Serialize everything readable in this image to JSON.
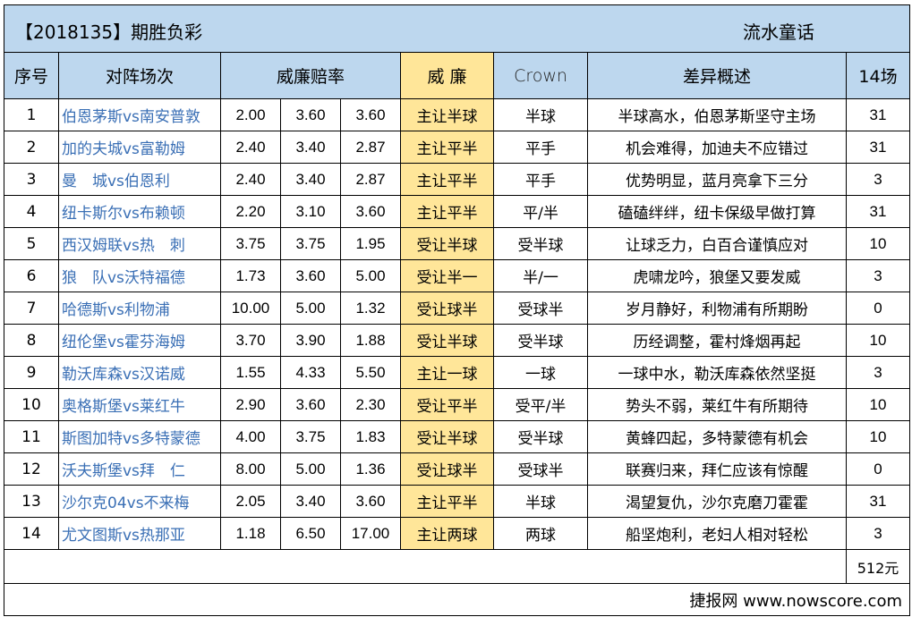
{
  "title": {
    "left": "【2018135】期胜负彩",
    "right": "流水童话"
  },
  "headers": {
    "index": "序号",
    "match": "对阵场次",
    "odds": "威廉赔率",
    "handicap": "威 廉",
    "crown": "Crown",
    "summary": "差异概述",
    "picks": "14场"
  },
  "rows": [
    {
      "index": "1",
      "match": "伯恩茅斯vs南安普敦",
      "odd1": "2.00",
      "odd2": "3.60",
      "odd3": "3.60",
      "handicap": "主让半球",
      "crown": "半球",
      "summary": "半球高水，伯恩茅斯坚守主场",
      "pick": "31"
    },
    {
      "index": "2",
      "match": "加的夫城vs富勒姆",
      "odd1": "2.40",
      "odd2": "3.40",
      "odd3": "2.87",
      "handicap": "主让平半",
      "crown": "平手",
      "summary": "机会难得，加迪夫不应错过",
      "pick": "31"
    },
    {
      "index": "3",
      "match": "曼　城vs伯恩利",
      "odd1": "2.40",
      "odd2": "3.40",
      "odd3": "2.87",
      "handicap": "主让平半",
      "crown": "平手",
      "summary": "优势明显，蓝月亮拿下三分",
      "pick": "3"
    },
    {
      "index": "4",
      "match": "纽卡斯尔vs布赖顿",
      "odd1": "2.20",
      "odd2": "3.10",
      "odd3": "3.60",
      "handicap": "主让平半",
      "crown": "平/半",
      "summary": "磕磕绊绊，纽卡保级早做打算",
      "pick": "31"
    },
    {
      "index": "5",
      "match": "西汉姆联vs热　刺",
      "odd1": "3.75",
      "odd2": "3.75",
      "odd3": "1.95",
      "handicap": "受让半球",
      "crown": "受半球",
      "summary": "让球乏力，白百合谨慎应对",
      "pick": "10"
    },
    {
      "index": "6",
      "match": "狼　队vs沃特福德",
      "odd1": "1.73",
      "odd2": "3.60",
      "odd3": "5.00",
      "handicap": "受让半一",
      "crown": "半/一",
      "summary": "虎啸龙吟，狼堡又要发威",
      "pick": "3"
    },
    {
      "index": "7",
      "match": "哈德斯vs利物浦",
      "odd1": "10.00",
      "odd2": "5.00",
      "odd3": "1.32",
      "handicap": "受让球半",
      "crown": "受球半",
      "summary": "岁月静好，利物浦有所期盼",
      "pick": "0"
    },
    {
      "index": "8",
      "match": "纽伦堡vs霍芬海姆",
      "odd1": "3.70",
      "odd2": "3.90",
      "odd3": "1.88",
      "handicap": "受让半球",
      "crown": "受半球",
      "summary": "历经调整，霍村烽烟再起",
      "pick": "10"
    },
    {
      "index": "9",
      "match": "勒沃库森vs汉诺威",
      "odd1": "1.55",
      "odd2": "4.33",
      "odd3": "5.50",
      "handicap": "主让一球",
      "crown": "一球",
      "summary": "一球中水，勒沃库森依然坚挺",
      "pick": "3"
    },
    {
      "index": "10",
      "match": "奥格斯堡vs莱红牛",
      "odd1": "2.90",
      "odd2": "3.60",
      "odd3": "2.30",
      "handicap": "受让平半",
      "crown": "受平/半",
      "summary": "势头不弱，莱红牛有所期待",
      "pick": "10"
    },
    {
      "index": "11",
      "match": "斯图加特vs多特蒙德",
      "odd1": "4.00",
      "odd2": "3.75",
      "odd3": "1.83",
      "handicap": "受让半球",
      "crown": "受半球",
      "summary": "黄蜂四起，多特蒙德有机会",
      "pick": "10"
    },
    {
      "index": "12",
      "match": "沃夫斯堡vs拜　仁",
      "odd1": "8.00",
      "odd2": "5.00",
      "odd3": "1.36",
      "handicap": "受让球半",
      "crown": "受球半",
      "summary": "联赛归来，拜仁应该有惊醒",
      "pick": "0"
    },
    {
      "index": "13",
      "match": "沙尔克04vs不来梅",
      "odd1": "2.05",
      "odd2": "3.40",
      "odd3": "3.60",
      "handicap": "主让平半",
      "crown": "半球",
      "summary": "渴望复仇，沙尔克磨刀霍霍",
      "pick": "31"
    },
    {
      "index": "14",
      "match": "尤文图斯vs热那亚",
      "odd1": "1.18",
      "odd2": "6.50",
      "odd3": "17.00",
      "handicap": "主让两球",
      "crown": "两球",
      "summary": "船坚炮利，老妇人相对轻松",
      "pick": "3"
    }
  ],
  "total": "512元",
  "footer": "捷报网 www.nowscore.com"
}
